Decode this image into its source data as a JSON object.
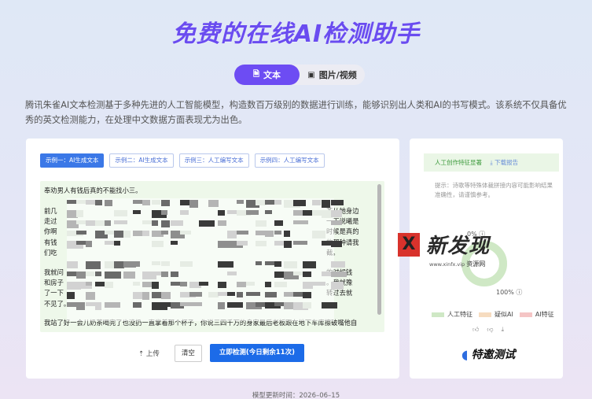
{
  "page": {
    "title": "免费的在线AI检测助手"
  },
  "tabs": [
    {
      "label": "文本",
      "icon": "document-icon",
      "active": true
    },
    {
      "label": "图片/视频",
      "icon": "image-icon",
      "active": false
    }
  ],
  "description": "腾讯朱雀AI文本检测基于多种先进的人工智能模型，构造数百万级别的数据进行训练，能够识别出人类和AI的书写模式。该系统不仅具备优秀的英文检测能力，在处理中文数据方面表现尤为出色。",
  "examples": [
    {
      "label": "示例一：AI生成文本",
      "active": true
    },
    {
      "label": "示例二：AI生成文本",
      "active": false
    },
    {
      "label": "示例三：人工编写文本",
      "active": false
    },
    {
      "label": "示例四：人工编写文本",
      "active": false
    }
  ],
  "input": {
    "line1": "奉劝男人有钱后真的不能找小三。",
    "p2_start": [
      "前几",
      "走过",
      "你啊",
      "有钱",
      "们吃"
    ],
    "p2_end": [
      "茶从她身边",
      "一下说曦是",
      "时候是真的",
      "的那种请我",
      "截。"
    ],
    "p3_start": [
      "我就问",
      "和房子",
      "了一下",
      "不见了。"
    ],
    "p3_end": [
      "的时候钱",
      "。我就豫",
      "转过去就"
    ],
    "p4": "我站了好一会儿奶茶喝完了也没扔一直掌着那个杯子，你说三四千万的身家最后老板跟在地下车库擦破嘴他自"
  },
  "actions": {
    "upload": "上传",
    "clear": "清空",
    "detect": "立即检测(今日剩余11次)"
  },
  "result": {
    "header": "人工创作特征显著",
    "download": "下载报告",
    "tip": "提示：诗歌等特殊体裁拼接内容可能影响结果准确性，请谨慎参考。",
    "ai_percent_label": "0%",
    "human_percent_label": "100%",
    "human_fraction": 1.0,
    "legend": [
      {
        "label": "人工特征",
        "color": "#cfe8c5"
      },
      {
        "label": "疑似AI",
        "color": "#f6dcc0"
      },
      {
        "label": "AI特征",
        "color": "#f5c5c5"
      }
    ],
    "brand": "特邀测试"
  },
  "watermark": {
    "mark": "X",
    "text": "新发现",
    "url": "www.xinfx.vip",
    "suffix": "资源网"
  },
  "footer": "模型更新时间：2026–06–15",
  "colors": {
    "accent": "#6d4cf3",
    "primary_button": "#1c6be8",
    "human": "#cfe8c5"
  }
}
